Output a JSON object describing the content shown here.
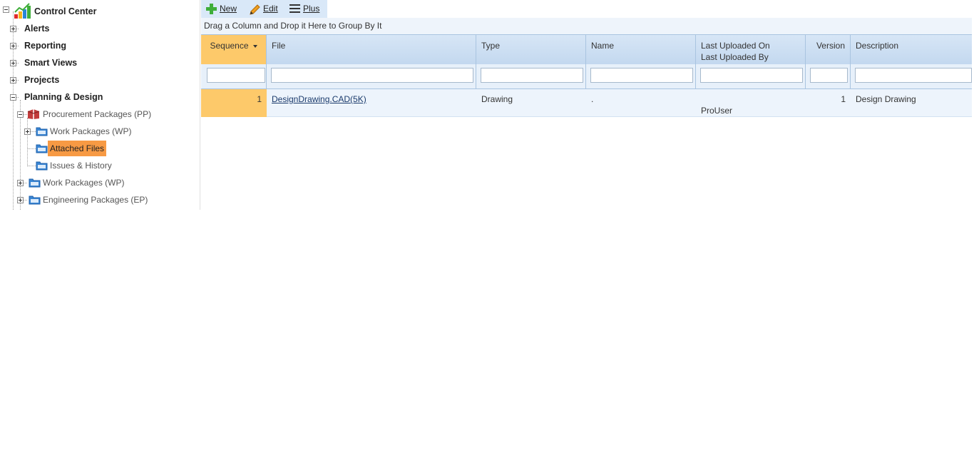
{
  "tree": {
    "root": "Control Center",
    "items": [
      {
        "label": "Alerts"
      },
      {
        "label": "Reporting"
      },
      {
        "label": "Smart Views"
      },
      {
        "label": "Projects"
      },
      {
        "label": "Planning & Design"
      }
    ],
    "procurement": "Procurement Packages (PP)",
    "pp_children": [
      "Work Packages (WP)",
      "Attached Files",
      "Issues & History"
    ],
    "pd_children": [
      "Work Packages (WP)",
      "Engineering Packages (EP)"
    ]
  },
  "toolbar": {
    "new_label": "New",
    "edit_label": "Edit",
    "plus_label": "Plus"
  },
  "grid": {
    "group_hint": "Drag a Column and Drop it Here to Group By It",
    "columns": {
      "sequence": "Sequence",
      "file": "File",
      "type": "Type",
      "name": "Name",
      "last_uploaded_on": "Last Uploaded On",
      "last_uploaded_by": "Last Uploaded By",
      "version": "Version",
      "description": "Description"
    },
    "rows": [
      {
        "sequence": "1",
        "file": "DesignDrawing.CAD(5K)",
        "type": "Drawing",
        "name": ".",
        "last_uploaded_on": "",
        "last_uploaded_by": "ProUser",
        "version": "1",
        "description": "Design Drawing"
      }
    ]
  },
  "colors": {
    "selected_node": "#f79a44",
    "sorted_column": "#fdc96a",
    "header_blue": "#c3d8ef",
    "toolbar_blue": "#d9e8f8"
  }
}
